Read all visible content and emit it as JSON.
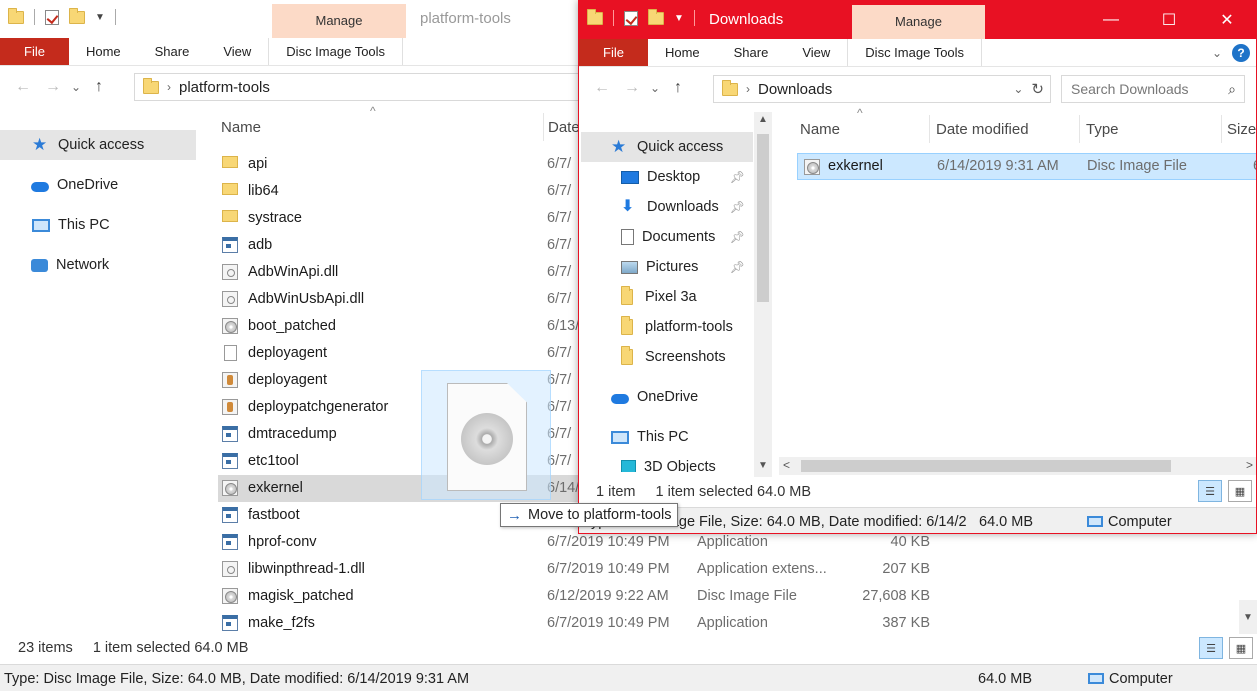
{
  "left_window": {
    "title": "platform-tools",
    "manage_label": "Manage",
    "ribbon_tabs": [
      "File",
      "Home",
      "Share",
      "View",
      "Disc Image Tools"
    ],
    "address": "platform-tools",
    "columns": {
      "name": "Name",
      "date": "Date"
    },
    "nav": [
      "Quick access",
      "OneDrive",
      "This PC",
      "Network"
    ],
    "files": [
      {
        "name": "api",
        "icon": "folder",
        "date": "6/7/",
        "type": "",
        "size": ""
      },
      {
        "name": "lib64",
        "icon": "folder",
        "date": "6/7/",
        "type": "",
        "size": ""
      },
      {
        "name": "systrace",
        "icon": "folder",
        "date": "6/7/",
        "type": "",
        "size": ""
      },
      {
        "name": "adb",
        "icon": "app",
        "date": "6/7/",
        "type": "",
        "size": ""
      },
      {
        "name": "AdbWinApi.dll",
        "icon": "dll",
        "date": "6/7/",
        "type": "",
        "size": ""
      },
      {
        "name": "AdbWinUsbApi.dll",
        "icon": "dll",
        "date": "6/7/",
        "type": "",
        "size": ""
      },
      {
        "name": "boot_patched",
        "icon": "disc",
        "date": "6/13/",
        "type": "",
        "size": ""
      },
      {
        "name": "deployagent",
        "icon": "blank",
        "date": "6/7/",
        "type": "",
        "size": ""
      },
      {
        "name": "deployagent",
        "icon": "jar",
        "date": "6/7/",
        "type": "",
        "size": ""
      },
      {
        "name": "deploypatchgenerator",
        "icon": "jar",
        "date": "6/7/",
        "type": "",
        "size": ""
      },
      {
        "name": "dmtracedump",
        "icon": "app",
        "date": "6/7/",
        "type": "",
        "size": ""
      },
      {
        "name": "etc1tool",
        "icon": "app",
        "date": "6/7/",
        "type": "",
        "size": ""
      },
      {
        "name": "exkernel",
        "icon": "disc",
        "date": "6/14/",
        "type": "",
        "size": "",
        "selected": true
      },
      {
        "name": "fastboot",
        "icon": "app",
        "date": "6/7/",
        "type": "",
        "size": ""
      },
      {
        "name": "hprof-conv",
        "icon": "app",
        "date": "6/7/2019 10:49 PM",
        "type": "Application",
        "size": "40 KB"
      },
      {
        "name": "libwinpthread-1.dll",
        "icon": "dll",
        "date": "6/7/2019 10:49 PM",
        "type": "Application extens...",
        "size": "207 KB"
      },
      {
        "name": "magisk_patched",
        "icon": "disc",
        "date": "6/12/2019 9:22 AM",
        "type": "Disc Image File",
        "size": "27,608 KB"
      },
      {
        "name": "make_f2fs",
        "icon": "app",
        "date": "6/7/2019 10:49 PM",
        "type": "Application",
        "size": "387 KB"
      }
    ],
    "status": {
      "items": "23 items",
      "selected": "1 item selected  64.0 MB"
    },
    "info": {
      "details": "Type: Disc Image File, Size: 64.0 MB, Date modified: 6/14/2019 9:31 AM",
      "size": "64.0 MB",
      "location": "Computer"
    }
  },
  "right_window": {
    "title": "Downloads",
    "manage_label": "Manage",
    "ribbon_tabs": [
      "File",
      "Home",
      "Share",
      "View",
      "Disc Image Tools"
    ],
    "address": "Downloads",
    "search_placeholder": "Search Downloads",
    "columns": {
      "name": "Name",
      "date": "Date modified",
      "type": "Type",
      "size": "Size"
    },
    "nav": [
      {
        "label": "Quick access",
        "icon": "star",
        "indent": 0,
        "selected": true,
        "pinned": false
      },
      {
        "label": "Desktop",
        "icon": "desktop",
        "indent": 1,
        "pinned": true
      },
      {
        "label": "Downloads",
        "icon": "download",
        "indent": 1,
        "pinned": true
      },
      {
        "label": "Documents",
        "icon": "document",
        "indent": 1,
        "pinned": true
      },
      {
        "label": "Pictures",
        "icon": "picture",
        "indent": 1,
        "pinned": true
      },
      {
        "label": "Pixel 3a",
        "icon": "folder",
        "indent": 1,
        "pinned": false
      },
      {
        "label": "platform-tools",
        "icon": "folder",
        "indent": 1,
        "pinned": false
      },
      {
        "label": "Screenshots",
        "icon": "folder",
        "indent": 1,
        "pinned": false
      },
      {
        "label": "OneDrive",
        "icon": "cloud",
        "indent": 0,
        "pinned": false
      },
      {
        "label": "This PC",
        "icon": "pc",
        "indent": 0,
        "pinned": false
      },
      {
        "label": "3D Objects",
        "icon": "cube",
        "indent": 1,
        "pinned": false
      }
    ],
    "files": [
      {
        "name": "exkernel",
        "date": "6/14/2019 9:31 AM",
        "type": "Disc Image File",
        "size": "6"
      }
    ],
    "status": {
      "items": "1 item",
      "selected": "1 item selected  64.0 MB"
    },
    "info": {
      "details": "Type: Disc Image File, Size: 64.0 MB, Date modified: 6/14/2",
      "size": "64.0 MB",
      "location": "Computer"
    }
  },
  "drag_tooltip": "Move to platform-tools",
  "colors": {
    "accent_red": "#e81123",
    "file_tab": "#c42b1c",
    "manage_bg": "#fcdac7",
    "selection_blue": "#cce8ff"
  }
}
